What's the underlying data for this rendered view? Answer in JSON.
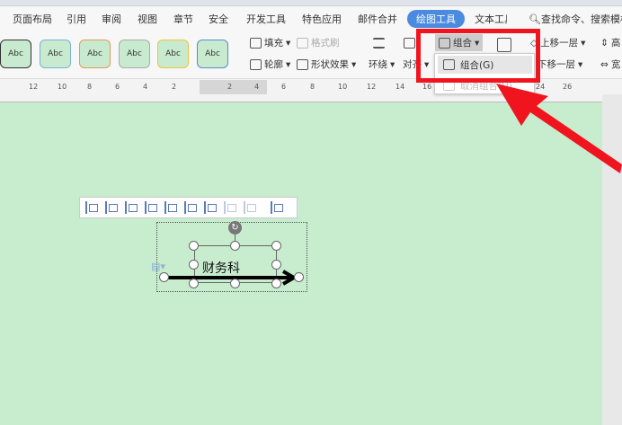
{
  "tabs": [
    "页面布局",
    "引用",
    "审阅",
    "视图",
    "章节",
    "安全",
    "开发工具",
    "特色应用",
    "邮件合并",
    "绘图工具",
    "文本工具"
  ],
  "active_tab": "绘图工具",
  "search_placeholder": "查找命令、搜索模板",
  "ribbon": {
    "style_samples": [
      "Abc",
      "Abc",
      "Abc",
      "Abc",
      "Abc",
      "Abc"
    ],
    "fill": "填充",
    "format_painter": "格式刷",
    "outline": "轮廓",
    "shape_effects": "形状效果",
    "wrap": "环绕",
    "align": "对齐",
    "group": "组合",
    "bring_forward": "上移一层",
    "send_backward": "下移一层",
    "height": "高",
    "width": "宽"
  },
  "dropdown": {
    "group": "组合(G)",
    "ungroup": "取消组合(U)"
  },
  "ruler": [
    "12",
    "10",
    "8",
    "6",
    "4",
    "2",
    "2",
    "4",
    "6",
    "8",
    "10",
    "12",
    "14",
    "16",
    "24",
    "26"
  ],
  "document": {
    "textbox_text": "财务科"
  },
  "colors": {
    "accent": "#4a8be0",
    "highlight": "#f0141e",
    "page": "#c7ecce"
  }
}
